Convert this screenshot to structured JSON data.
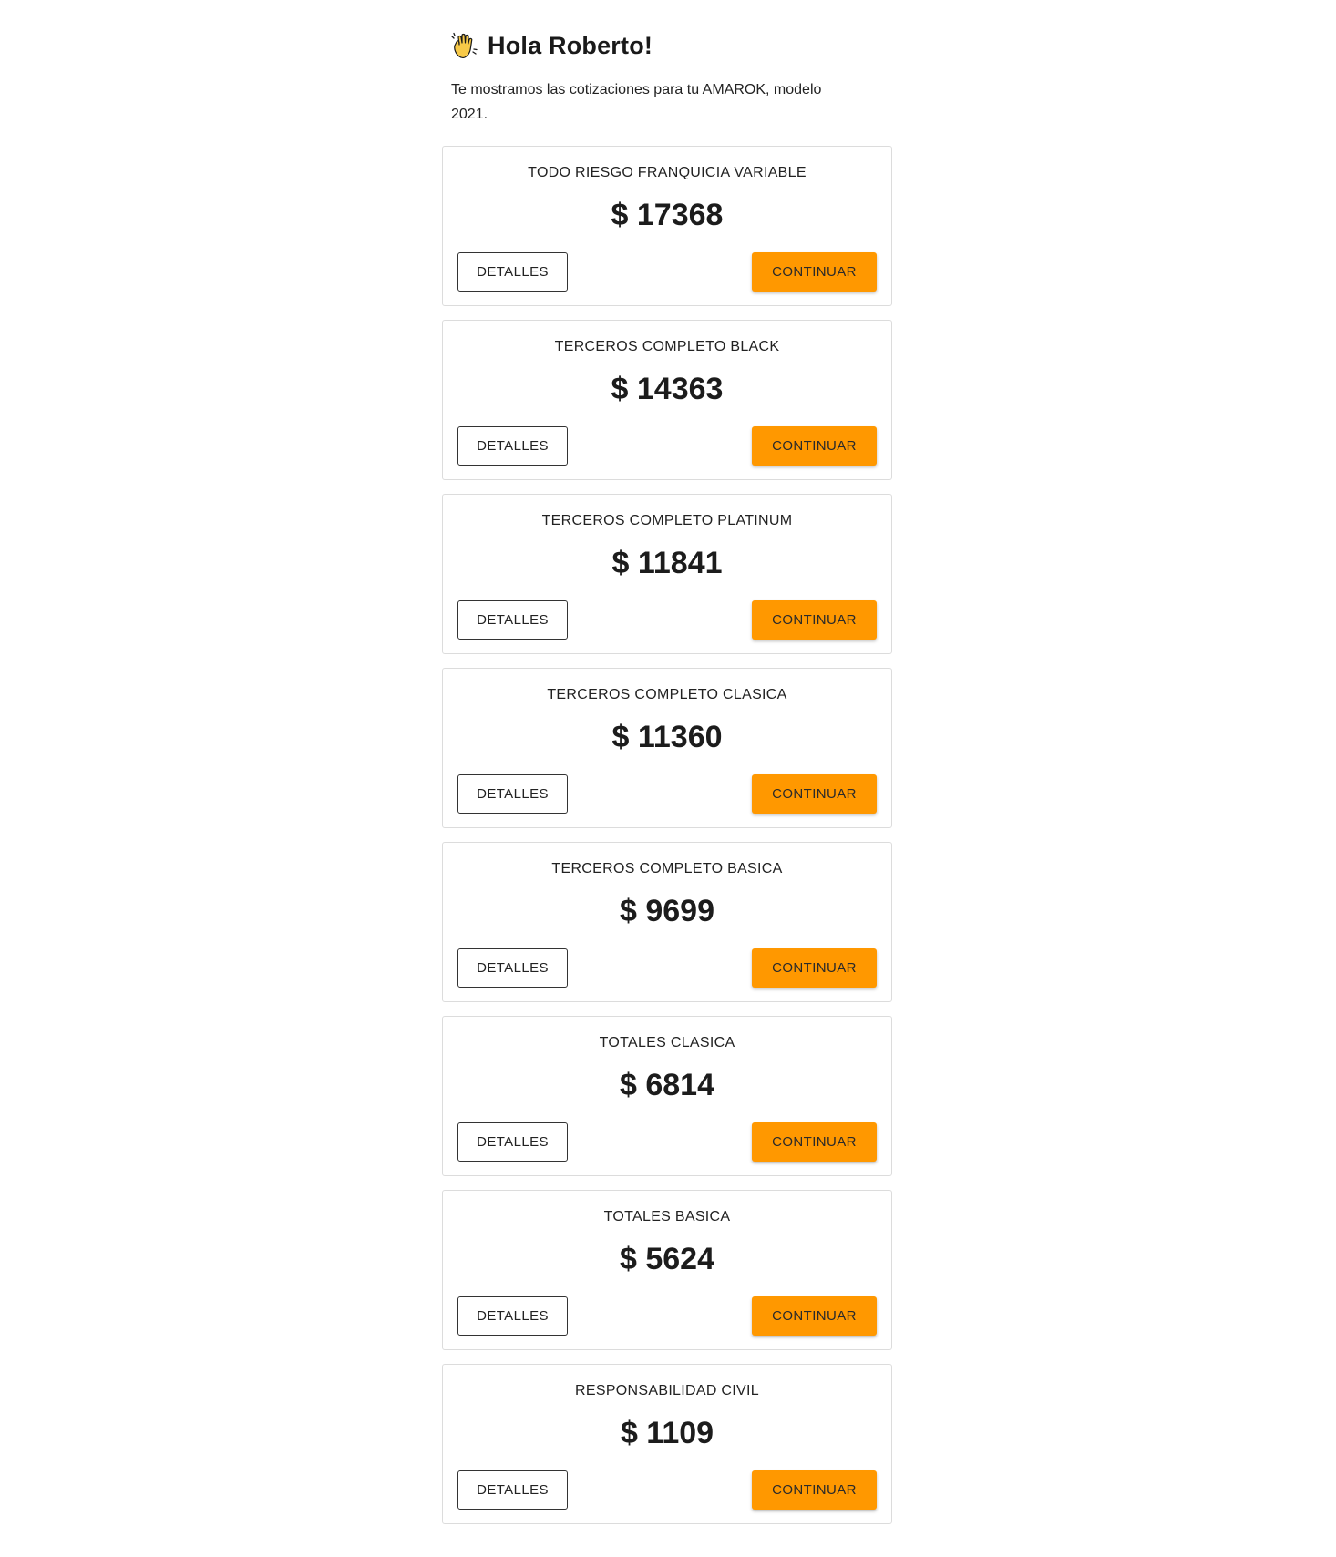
{
  "greeting": {
    "icon": "waving-hand-icon",
    "title": "Hola Roberto!"
  },
  "intro": {
    "text_line1": "Te mostramos las cotizaciones para tu AMAROK, modelo",
    "text_line2": "2021."
  },
  "colors": {
    "accent": "#ff9800",
    "border": "#dcdcdc"
  },
  "quotes": [
    {
      "name": "TODO RIESGO FRANQUICIA VARIABLE",
      "price": "$ 17368",
      "details_label": "DETALLES",
      "continue_label": "CONTINUAR"
    },
    {
      "name": "TERCEROS COMPLETO BLACK",
      "price": "$ 14363",
      "details_label": "DETALLES",
      "continue_label": "CONTINUAR"
    },
    {
      "name": "TERCEROS COMPLETO PLATINUM",
      "price": "$ 11841",
      "details_label": "DETALLES",
      "continue_label": "CONTINUAR"
    },
    {
      "name": "TERCEROS COMPLETO CLASICA",
      "price": "$ 11360",
      "details_label": "DETALLES",
      "continue_label": "CONTINUAR"
    },
    {
      "name": "TERCEROS COMPLETO BASICA",
      "price": "$ 9699",
      "details_label": "DETALLES",
      "continue_label": "CONTINUAR"
    },
    {
      "name": "TOTALES CLASICA",
      "price": "$ 6814",
      "details_label": "DETALLES",
      "continue_label": "CONTINUAR"
    },
    {
      "name": "TOTALES BASICA",
      "price": "$ 5624",
      "details_label": "DETALLES",
      "continue_label": "CONTINUAR"
    },
    {
      "name": "RESPONSABILIDAD CIVIL",
      "price": "$ 1109",
      "details_label": "DETALLES",
      "continue_label": "CONTINUAR"
    }
  ]
}
